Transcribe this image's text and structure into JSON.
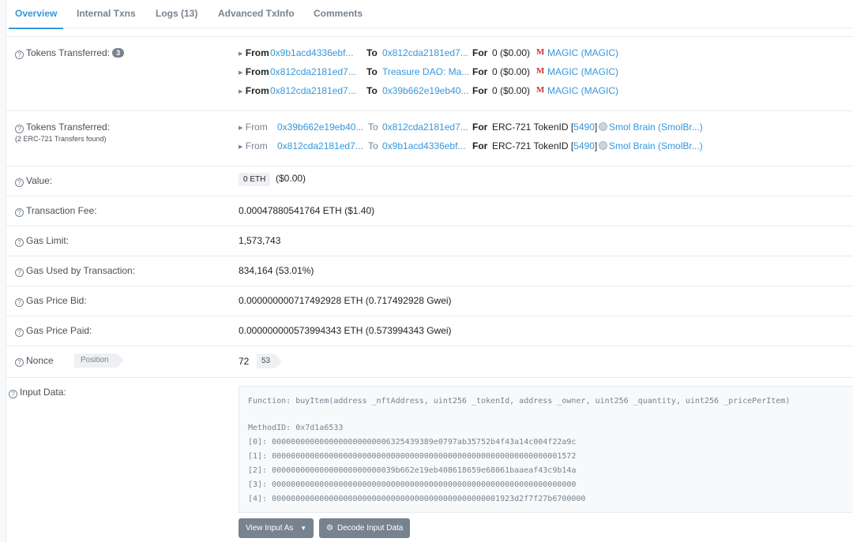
{
  "tabs": [
    {
      "label": "Overview",
      "active": true
    },
    {
      "label": "Internal Txns"
    },
    {
      "label": "Logs (13)"
    },
    {
      "label": "Advanced TxInfo"
    },
    {
      "label": "Comments"
    }
  ],
  "tokens_transferred": {
    "label": "Tokens Transferred:",
    "count": "3",
    "rows": [
      {
        "from_kw": "From",
        "from": "0x9b1acd4336ebf...",
        "to_kw": "To",
        "to": "0x812cda2181ed7...",
        "for_kw": "For",
        "amount": "0 ($0.00)",
        "token_icon": "M",
        "token": "MAGIC (MAGIC)"
      },
      {
        "from_kw": "From",
        "from": "0x812cda2181ed7...",
        "to_kw": "To",
        "to": "Treasure DAO: Ma...",
        "for_kw": "For",
        "amount": "0 ($0.00)",
        "token_icon": "M",
        "token": "MAGIC (MAGIC)"
      },
      {
        "from_kw": "From",
        "from": "0x812cda2181ed7...",
        "to_kw": "To",
        "to": "0x39b662e19eb40...",
        "for_kw": "For",
        "amount": "0 ($0.00)",
        "token_icon": "M",
        "token": "MAGIC (MAGIC)"
      }
    ]
  },
  "nft_transferred": {
    "label": "Tokens Transferred:",
    "sublabel": "(2 ERC-721 Transfers found)",
    "rows": [
      {
        "from_kw": "From",
        "from": "0x39b662e19eb40...",
        "to_kw": "To",
        "to": "0x812cda2181ed7...",
        "for_kw": "For",
        "standard": "ERC-721 TokenID [",
        "token_id": "5490",
        "close": "]",
        "token": "Smol Brain (SmolBr...)"
      },
      {
        "from_kw": "From",
        "from": "0x812cda2181ed7...",
        "to_kw": "To",
        "to": "0x9b1acd4336ebf...",
        "for_kw": "For",
        "standard": "ERC-721 TokenID [",
        "token_id": "5490",
        "close": "]",
        "token": "Smol Brain (SmolBr...)"
      }
    ]
  },
  "value": {
    "label": "Value:",
    "chip": "0 ETH",
    "usd": "($0.00)"
  },
  "fee": {
    "label": "Transaction Fee:",
    "text": "0.00047880541764 ETH ($1.40)"
  },
  "gas_limit": {
    "label": "Gas Limit:",
    "text": "1,573,743"
  },
  "gas_used": {
    "label": "Gas Used by Transaction:",
    "text": "834,164 (53.01%)"
  },
  "gas_bid": {
    "label": "Gas Price Bid:",
    "text": "0.000000000717492928 ETH (0.717492928 Gwei)"
  },
  "gas_paid": {
    "label": "Gas Price Paid:",
    "text": "0.000000000573994343 ETH (0.573994343 Gwei)"
  },
  "nonce": {
    "label": "Nonce",
    "position_label": "Position",
    "value": "72",
    "position": "53"
  },
  "input_data": {
    "label": "Input Data:",
    "function": "Function: buyItem(address _nftAddress, uint256 _tokenId, address _owner, uint256 _quantity, uint256 _pricePerItem)",
    "method_id": "MethodID: 0x7d1a6533",
    "params": [
      "[0]:  0000000000000000000000006325439389e0797ab35752b4f43a14c004f22a9c",
      "[1]:  0000000000000000000000000000000000000000000000000000000000001572",
      "[2]:  00000000000000000000000039b662e19eb408618659e68061baaeaf43c9b14a",
      "[3]:  0000000000000000000000000000000000000000000000000000000000000000",
      "[4]:  000000000000000000000000000000000000000000000001923d2f7f27b6700000"
    ],
    "view_button": "View Input As",
    "decode_button": "Decode Input Data"
  }
}
